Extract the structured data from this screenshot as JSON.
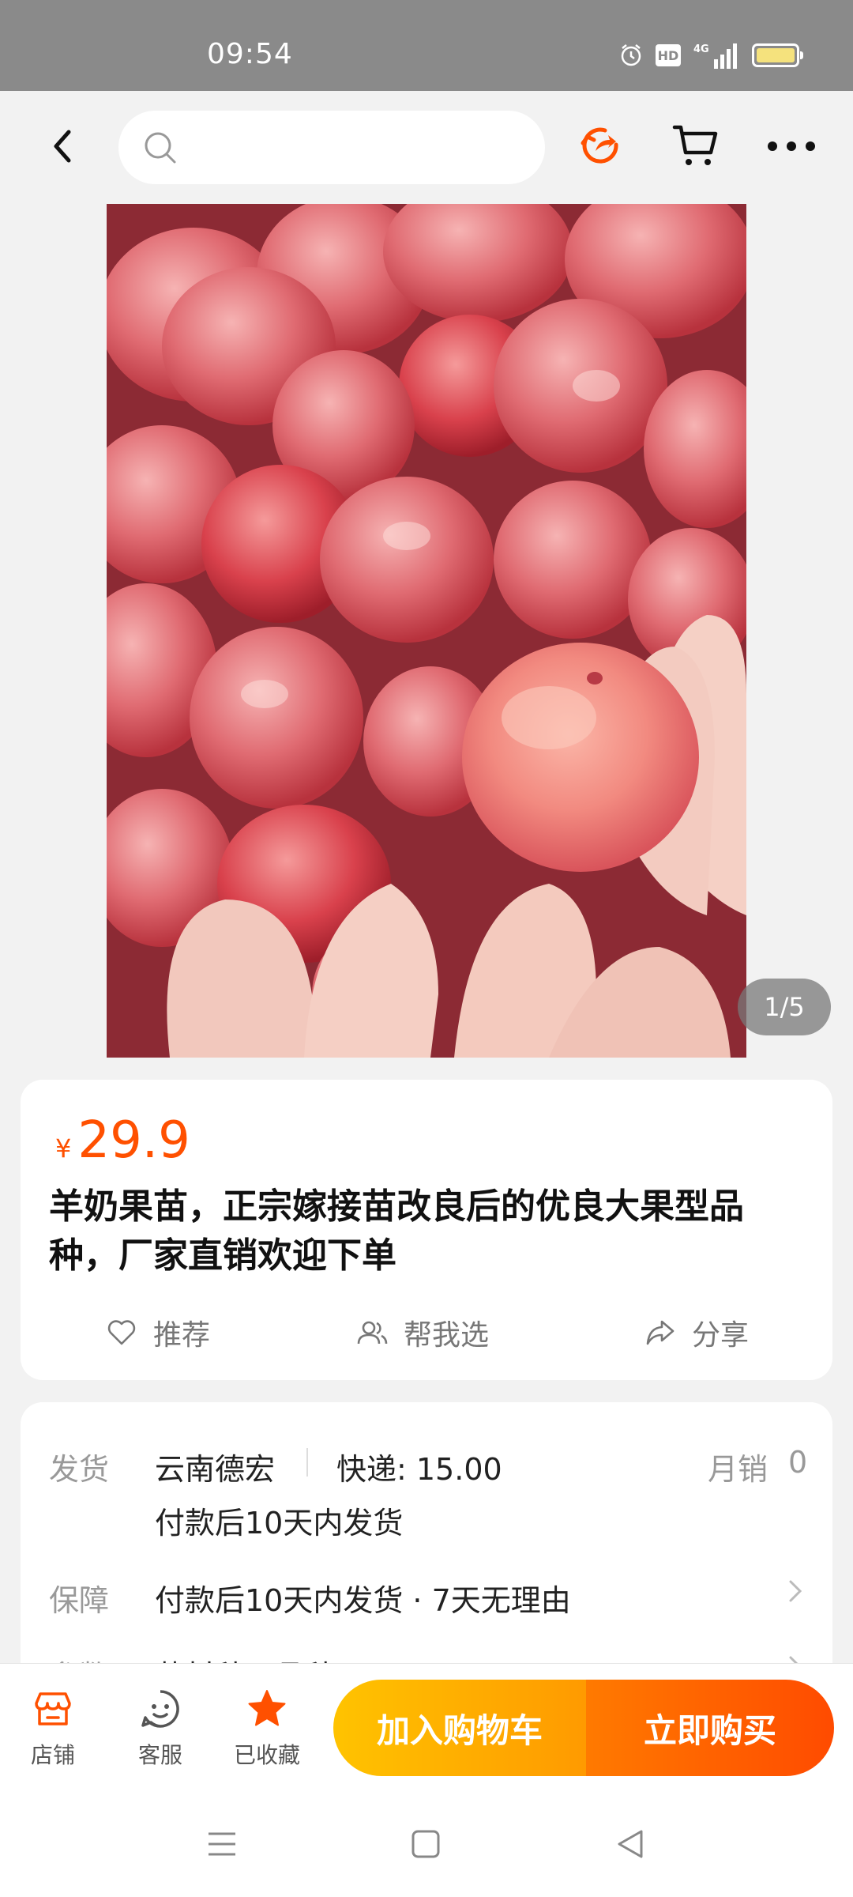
{
  "status_bar": {
    "time": "09:54",
    "hd_label": "HD",
    "network_label": "4G",
    "icons": [
      "alarm-icon",
      "hd-icon",
      "signal-icon",
      "battery-icon"
    ]
  },
  "nav": {
    "search_placeholder": "",
    "icons": [
      "back-icon",
      "search-icon",
      "share-circle-icon",
      "cart-icon",
      "more-icon"
    ],
    "accent_color": "#ff5000"
  },
  "gallery": {
    "counter": "1/5"
  },
  "product": {
    "price_symbol": "¥",
    "price": "29.9",
    "title": "羊奶果苗，正宗嫁接苗改良后的优良大果型品种，厂家直销欢迎下单",
    "actions": [
      {
        "label": "推荐",
        "icon": "heart-icon"
      },
      {
        "label": "帮我选",
        "icon": "people-icon"
      },
      {
        "label": "分享",
        "icon": "share-icon"
      }
    ]
  },
  "details": {
    "shipping": {
      "label": "发货",
      "origin": "云南德宏",
      "express": "快递: 15.00",
      "monthly_sales_label": "月销",
      "monthly_sales": "0",
      "note": "付款后10天内发货"
    },
    "guarantee": {
      "label": "保障",
      "text": "付款后10天内发货 · 7天无理由"
    },
    "params": {
      "label": "参数",
      "text": "药材种子品种"
    }
  },
  "bottom_bar": {
    "store": "店铺",
    "service": "客服",
    "favorited": "已收藏",
    "add_to_cart": "加入购物车",
    "buy_now": "立即购买"
  }
}
